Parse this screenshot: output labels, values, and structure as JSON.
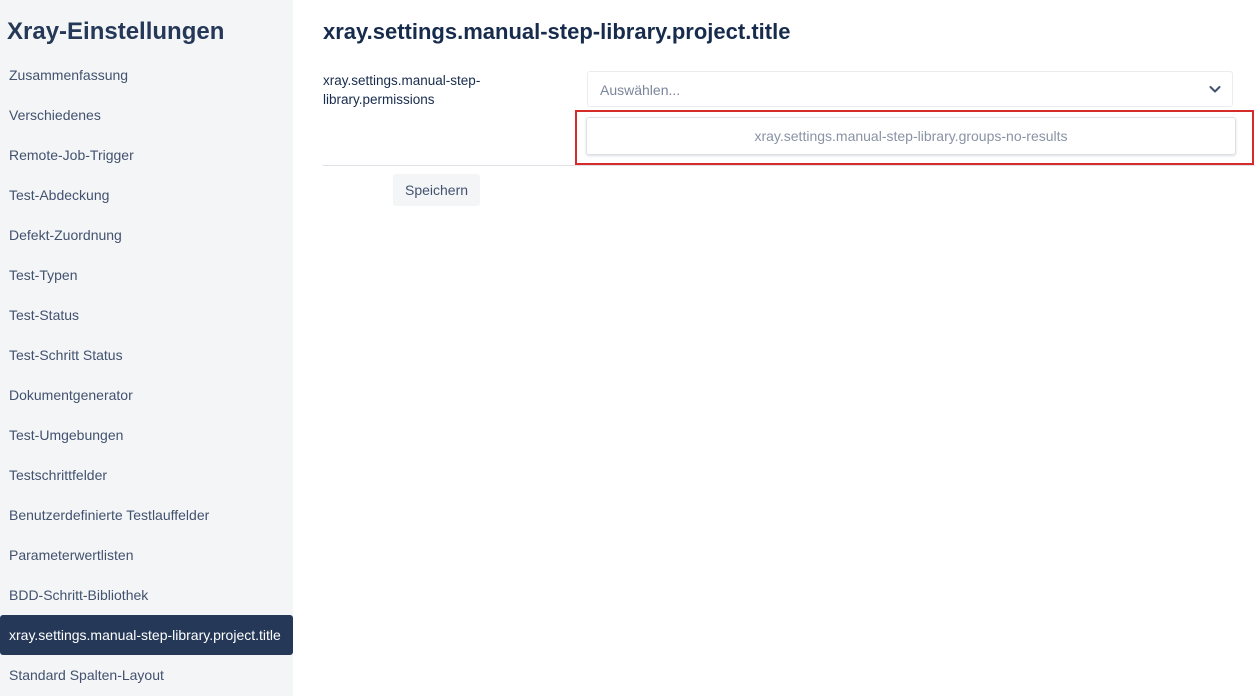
{
  "sidebar": {
    "title": "Xray-Einstellungen",
    "items": [
      {
        "label": "Zusammenfassung",
        "active": false
      },
      {
        "label": "Verschiedenes",
        "active": false
      },
      {
        "label": "Remote-Job-Trigger",
        "active": false
      },
      {
        "label": "Test-Abdeckung",
        "active": false
      },
      {
        "label": "Defekt-Zuordnung",
        "active": false
      },
      {
        "label": "Test-Typen",
        "active": false
      },
      {
        "label": "Test-Status",
        "active": false
      },
      {
        "label": "Test-Schritt Status",
        "active": false
      },
      {
        "label": "Dokumentgenerator",
        "active": false
      },
      {
        "label": "Test-Umgebungen",
        "active": false
      },
      {
        "label": "Testschrittfelder",
        "active": false
      },
      {
        "label": "Benutzerdefinierte Testlauffelder",
        "active": false
      },
      {
        "label": "Parameterwertlisten",
        "active": false
      },
      {
        "label": "BDD-Schritt-Bibliothek",
        "active": false
      },
      {
        "label": "xray.settings.manual-step-library.project.title",
        "active": true
      },
      {
        "label": "Standard Spalten-Layout",
        "active": false
      }
    ]
  },
  "main": {
    "title": "xray.settings.manual-step-library.project.title",
    "permissions_label": "xray.settings.manual-step-library.permissions",
    "select": {
      "placeholder": "Auswählen..."
    },
    "dropdown": {
      "no_results": "xray.settings.manual-step-library.groups-no-results"
    },
    "save_label": "Speichern"
  },
  "colors": {
    "sidebar_bg": "#f4f5f7",
    "active_item_bg": "#253858",
    "highlight_border": "#d52b2b"
  }
}
